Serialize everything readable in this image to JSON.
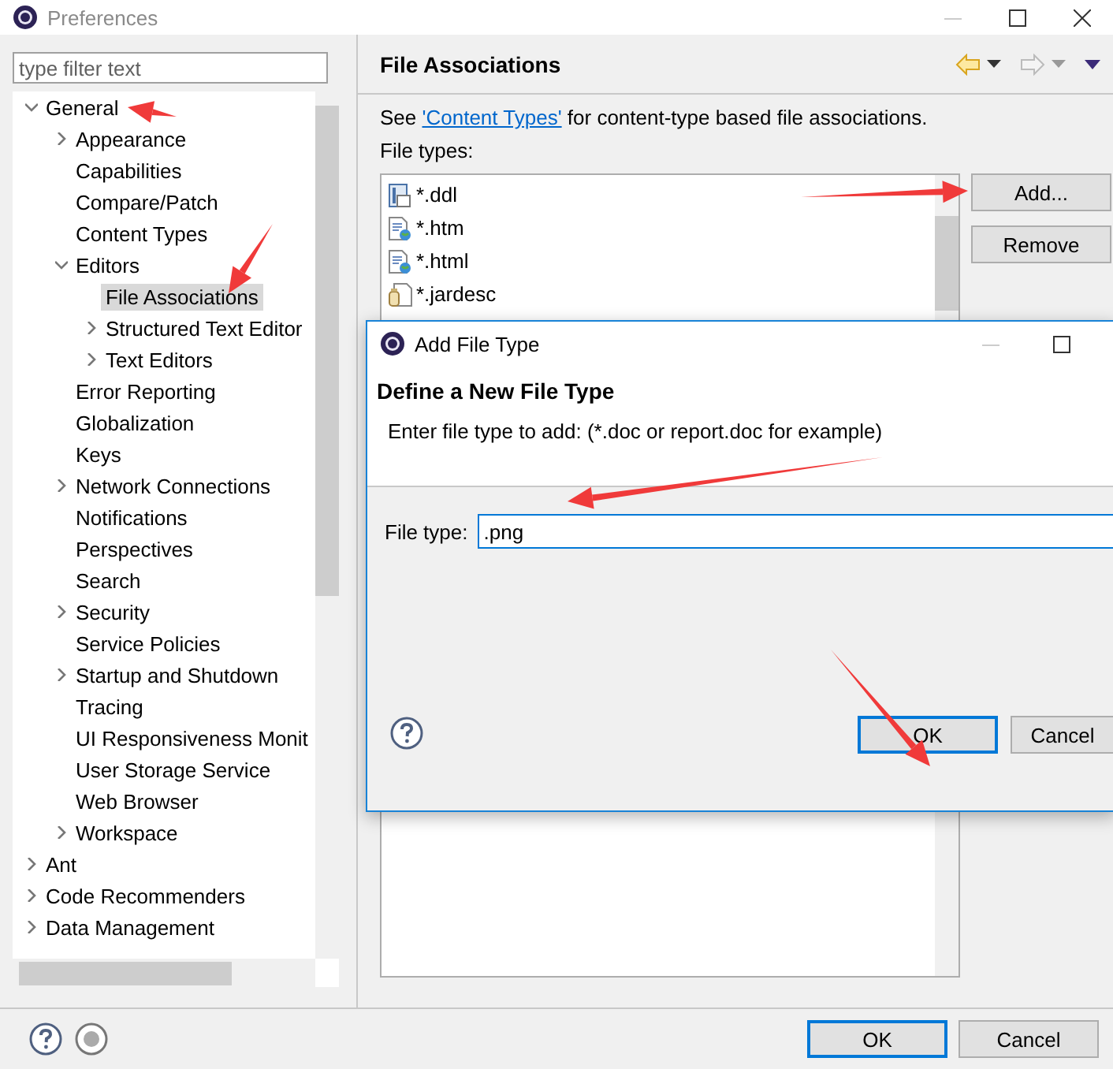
{
  "window": {
    "title": "Preferences"
  },
  "filter": {
    "placeholder": "type filter text"
  },
  "tree": [
    {
      "label": "General",
      "expanded": true,
      "selected": false,
      "children": [
        {
          "label": "Appearance",
          "expanded": false,
          "selected": false
        },
        {
          "label": "Capabilities",
          "selected": false
        },
        {
          "label": "Compare/Patch",
          "selected": false
        },
        {
          "label": "Content Types",
          "selected": false
        },
        {
          "label": "Editors",
          "expanded": true,
          "selected": false,
          "children": [
            {
              "label": "File Associations",
              "selected": true
            },
            {
              "label": "Structured Text Editor",
              "expanded": false,
              "selected": false
            },
            {
              "label": "Text Editors",
              "expanded": false,
              "selected": false
            }
          ]
        },
        {
          "label": "Error Reporting",
          "selected": false
        },
        {
          "label": "Globalization",
          "selected": false
        },
        {
          "label": "Keys",
          "selected": false
        },
        {
          "label": "Network Connections",
          "expanded": false,
          "selected": false
        },
        {
          "label": "Notifications",
          "selected": false
        },
        {
          "label": "Perspectives",
          "selected": false
        },
        {
          "label": "Search",
          "selected": false
        },
        {
          "label": "Security",
          "expanded": false,
          "selected": false
        },
        {
          "label": "Service Policies",
          "selected": false
        },
        {
          "label": "Startup and Shutdown",
          "expanded": false,
          "selected": false
        },
        {
          "label": "Tracing",
          "selected": false
        },
        {
          "label": "UI Responsiveness Monit",
          "selected": false
        },
        {
          "label": "User Storage Service",
          "selected": false
        },
        {
          "label": "Web Browser",
          "selected": false
        },
        {
          "label": "Workspace",
          "expanded": false,
          "selected": false
        }
      ]
    },
    {
      "label": "Ant",
      "expanded": false,
      "selected": false
    },
    {
      "label": "Code Recommenders",
      "expanded": false,
      "selected": false
    },
    {
      "label": "Data Management",
      "expanded": false,
      "selected": false
    }
  ],
  "page": {
    "title": "File Associations",
    "intro_before": "See ",
    "intro_link": "'Content Types'",
    "intro_after": " for content-type based file associations.",
    "file_types_label": "File types:",
    "file_types": [
      {
        "label": "*.ddl",
        "kind": "ddl"
      },
      {
        "label": "*.htm",
        "kind": "web"
      },
      {
        "label": "*.html",
        "kind": "web"
      },
      {
        "label": "*.jardesc",
        "kind": "jar"
      }
    ],
    "buttons": [
      "Add...",
      "Remove"
    ]
  },
  "footer": {
    "buttons": [
      {
        "label": "OK",
        "default": true
      },
      {
        "label": "Cancel",
        "default": false
      }
    ]
  },
  "dialog": {
    "title": "Add File Type",
    "heading": "Define a New File Type",
    "description": "Enter file type to add: (*.doc or report.doc for example)",
    "field_label": "File type:",
    "field_value": ".png",
    "buttons": [
      {
        "label": "OK",
        "default": true
      },
      {
        "label": "Cancel",
        "default": false
      }
    ]
  }
}
